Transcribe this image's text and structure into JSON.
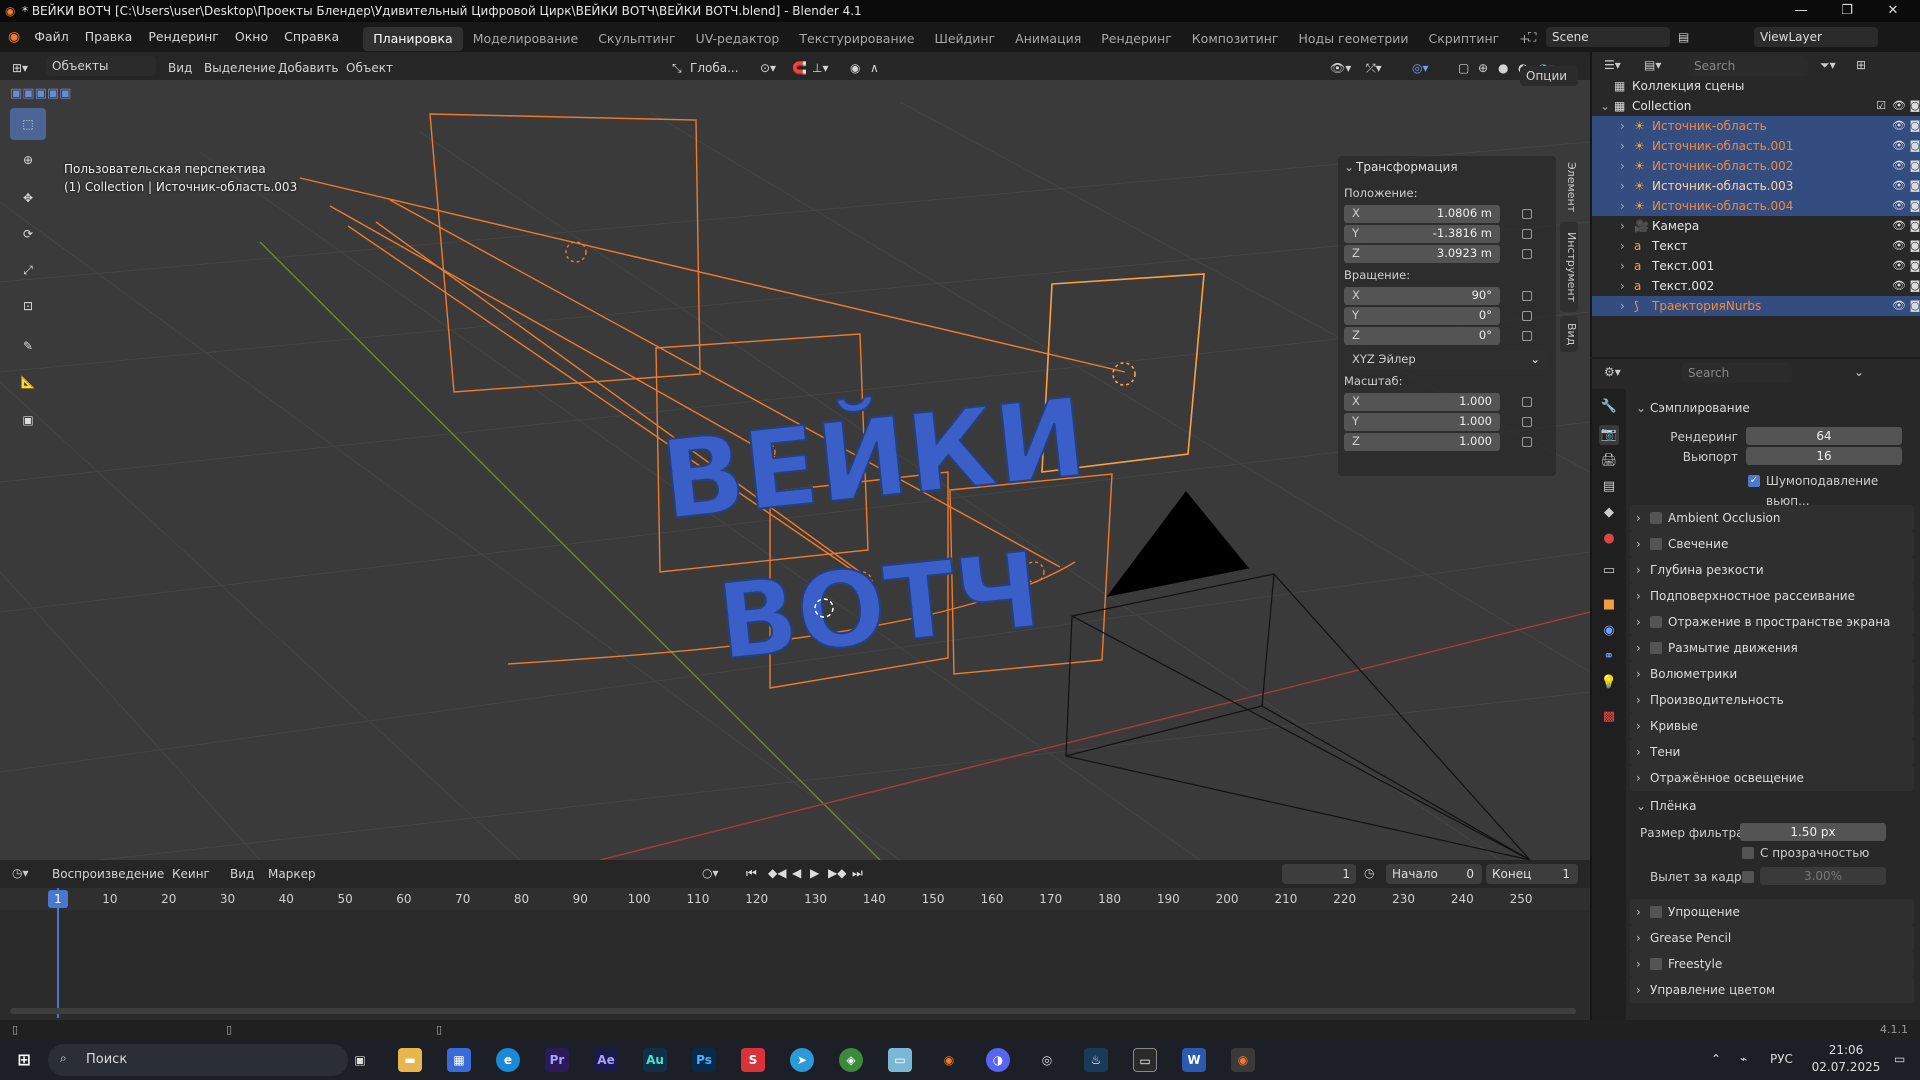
{
  "window": {
    "title": "* ВЕЙКИ ВОТЧ [C:\\Users\\user\\Desktop\\Проекты Блендер\\Удивительный Цифровой Цирк\\ВЕЙКИ ВОТЧ\\ВЕЙКИ ВОТЧ.blend] - Blender 4.1"
  },
  "menu": {
    "items": [
      "Файл",
      "Правка",
      "Рендеринг",
      "Окно",
      "Справка"
    ],
    "workspaces": [
      "Планировка",
      "Моделирование",
      "Скульптинг",
      "UV-редактор",
      "Текстурирование",
      "Шейдинг",
      "Анимация",
      "Рендеринг",
      "Композитинг",
      "Ноды геометрии",
      "Скриптинг"
    ],
    "active_workspace": "Планировка",
    "add_workspace": "+",
    "scene": "Scene",
    "view_layer": "ViewLayer"
  },
  "viewport": {
    "mode": "Объекты",
    "menu": [
      "Вид",
      "Выделение",
      "Добавить",
      "Объект"
    ],
    "orientation": "Глоба...",
    "options": "Опции",
    "info_line1": "Пользовательская перспектива",
    "info_line2": "(1) Collection | Источник-область.003",
    "text_3d_line1": "ВЕЙКИ",
    "text_3d_line2": "ВОТЧ",
    "text_color": "#3a5fc8",
    "selected_color": "#f07a2c",
    "active_color": "#ffa040"
  },
  "npanel": {
    "section": "Трансформация",
    "location_label": "Положение:",
    "location": [
      {
        "axis": "X",
        "value": "1.0806 m"
      },
      {
        "axis": "Y",
        "value": "-1.3816 m"
      },
      {
        "axis": "Z",
        "value": "3.0923 m"
      }
    ],
    "rotation_label": "Вращение:",
    "rotation": [
      {
        "axis": "X",
        "value": "90°"
      },
      {
        "axis": "Y",
        "value": "0°"
      },
      {
        "axis": "Z",
        "value": "0°"
      }
    ],
    "rotation_mode": "XYZ Эйлер",
    "scale_label": "Масштаб:",
    "scale": [
      {
        "axis": "X",
        "value": "1.000"
      },
      {
        "axis": "Y",
        "value": "1.000"
      },
      {
        "axis": "Z",
        "value": "1.000"
      }
    ],
    "tabs": [
      "Элемент",
      "Инструмент",
      "Вид"
    ]
  },
  "outliner": {
    "search_placeholder": "Search",
    "scene_collection": "Коллекция сцены",
    "rows": [
      {
        "name": "Collection",
        "selected": false,
        "color": "#e6e6e6"
      },
      {
        "name": "Источник-область",
        "selected": true,
        "color": "#f08a3c"
      },
      {
        "name": "Источник-область.001",
        "selected": true,
        "color": "#f08a3c"
      },
      {
        "name": "Источник-область.002",
        "selected": true,
        "color": "#f08a3c"
      },
      {
        "name": "Источник-область.003",
        "selected": true,
        "color": "#ffd2a0"
      },
      {
        "name": "Источник-область.004",
        "selected": true,
        "color": "#f08a3c"
      },
      {
        "name": "Камера",
        "selected": false,
        "color": "#e6e6e6"
      },
      {
        "name": "Текст",
        "selected": false,
        "color": "#e6e6e6"
      },
      {
        "name": "Текст.001",
        "selected": false,
        "color": "#e6e6e6"
      },
      {
        "name": "Текст.002",
        "selected": false,
        "color": "#e6e6e6"
      },
      {
        "name": "ТраекторияNurbs",
        "selected": true,
        "color": "#f08a3c"
      }
    ]
  },
  "properties": {
    "search_placeholder": "Search",
    "sampling": "Сэмплирование",
    "render_label": "Рендеринг",
    "render_value": "64",
    "viewport_label": "Вьюпорт",
    "viewport_value": "16",
    "denoise_label": "Шумоподавление вьюп...",
    "sections": [
      {
        "label": "Ambient Occlusion",
        "checkbox": true
      },
      {
        "label": "Свечение",
        "checkbox": true
      },
      {
        "label": "Глубина резкости",
        "checkbox": false
      },
      {
        "label": "Подповерхностное рассеивание",
        "checkbox": false
      },
      {
        "label": "Отражение в пространстве экрана",
        "checkbox": true
      },
      {
        "label": "Размытие движения",
        "checkbox": true
      },
      {
        "label": "Волюметрики",
        "checkbox": false
      },
      {
        "label": "Производительность",
        "checkbox": false
      },
      {
        "label": "Кривые",
        "checkbox": false
      },
      {
        "label": "Тени",
        "checkbox": false
      },
      {
        "label": "Отражённое освещение",
        "checkbox": false
      }
    ],
    "film": "Плёнка",
    "filter_size_label": "Размер фильтра",
    "filter_size_value": "1.50 px",
    "transparent_label": "С прозрачностью",
    "overscan_label": "Вылет за кадр",
    "overscan_value": "3.00%",
    "sections2": [
      {
        "label": "Упрощение",
        "checkbox": true
      },
      {
        "label": "Grease Pencil",
        "checkbox": false
      },
      {
        "label": "Freestyle",
        "checkbox": true
      },
      {
        "label": "Управление цветом",
        "checkbox": false
      }
    ]
  },
  "timeline": {
    "menu": [
      "Воспроизведение",
      "Кеинг",
      "Вид",
      "Маркер"
    ],
    "current_frame": "1",
    "start_label": "Начало",
    "start": "0",
    "end_label": "Конец",
    "end": "1",
    "ruler": [
      "1",
      "10",
      "20",
      "30",
      "40",
      "50",
      "60",
      "70",
      "80",
      "90",
      "100",
      "110",
      "120",
      "130",
      "140",
      "150",
      "160",
      "170",
      "180",
      "190",
      "200",
      "210",
      "220",
      "230",
      "240",
      "250"
    ]
  },
  "statusbar": {
    "version": "4.1.1"
  },
  "taskbar": {
    "search": "Поиск",
    "lang": "РУС",
    "time": "21:06",
    "date": "02.07.2025"
  }
}
